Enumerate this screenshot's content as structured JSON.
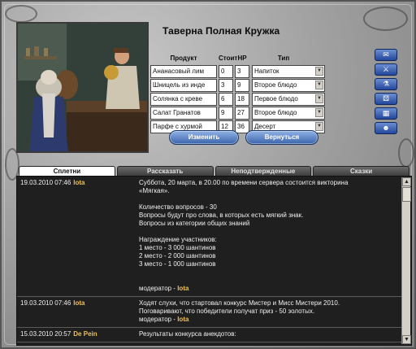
{
  "window": {
    "title": "Таверна Полная Кружка"
  },
  "products": {
    "headers": {
      "name": "Продукт",
      "cost": "Стоит",
      "hp": "HP",
      "type": "Тип"
    },
    "rows": [
      {
        "name": "Ананасовый лим",
        "cost": "0",
        "hp": "3",
        "type": "Напиток"
      },
      {
        "name": "Шницель из инде",
        "cost": "3",
        "hp": "9",
        "type": "Второе блюдо"
      },
      {
        "name": "Солянка с креве",
        "cost": "6",
        "hp": "18",
        "type": "Первое блюдо"
      },
      {
        "name": "Салат Гранатов",
        "cost": "9",
        "hp": "27",
        "type": "Второе блюдо"
      },
      {
        "name": "Парфе с хурмой",
        "cost": "12",
        "hp": "36",
        "type": "Десерт"
      }
    ]
  },
  "actions": {
    "change": "Изменить",
    "back": "Вернуться"
  },
  "tabs": [
    {
      "label": "Сплетни",
      "active": true
    },
    {
      "label": "Рассказать",
      "active": false
    },
    {
      "label": "Неподтвержденные",
      "active": false
    },
    {
      "label": "Сказки",
      "active": false
    }
  ],
  "messages": [
    {
      "date": "19.03.2010 07:46",
      "author": "lota",
      "lines": [
        "Суббота, 20 марта, в 20.00 по времени сервера состоится викторина",
        "«Мягкая».",
        "",
        "Количество вопросов - 30",
        "Вопросы будут про слова, в которых есть мягкий знак.",
        "Вопросы из категории общих знаний",
        "",
        "Награждение участников:",
        "1 место - 3 000 шантинов",
        "2 место - 2 000 шантинов",
        "3 место - 1 000 шантинов",
        "",
        ""
      ],
      "moderator_prefix": "модератор - ",
      "moderator": "lota"
    },
    {
      "date": "19.03.2010 07:46",
      "author": "lota",
      "lines": [
        "Ходят слухи, что стартовал конкурс Мистер и Мисс Мистери 2010.",
        "Поговаривают, что победители получат приз - 50 золотых."
      ],
      "moderator_prefix": "модератор - ",
      "moderator": "lota"
    },
    {
      "date": "15.03.2010 20:57",
      "author": "De Pein",
      "lines": [
        "Результаты конкурса анекдотов:"
      ],
      "moderator_prefix": "",
      "moderator": ""
    }
  ],
  "icons": [
    "scroll-icon",
    "swords-icon",
    "flask-icon",
    "dice-icon",
    "grid-icon",
    "people-icon"
  ],
  "colors": {
    "accent_blue": "#3c64aa",
    "author_gold": "#f1c14a",
    "chat_bg": "#1f1f1f"
  }
}
